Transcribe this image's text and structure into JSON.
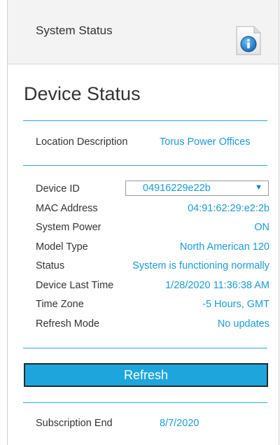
{
  "header": {
    "title": "System Status",
    "info_icon": "info-icon"
  },
  "page_title": "Device Status",
  "location": {
    "label": "Location Description",
    "value": "Torus Power Offices"
  },
  "device_select": {
    "label": "Device ID",
    "value": "04916229e22b",
    "arrow_icon": "chevron-down-icon"
  },
  "info_rows": [
    {
      "label": "MAC Address",
      "value": "04:91:62:29:e2:2b"
    },
    {
      "label": "System Power",
      "value": "ON"
    },
    {
      "label": "Model Type",
      "value": "North American 120"
    },
    {
      "label": "Status",
      "value": "System is functioning normally"
    },
    {
      "label": "Device Last Time",
      "value": "1/28/2020 11:36:38 AM"
    },
    {
      "label": "Time Zone",
      "value": "-5 Hours, GMT"
    },
    {
      "label": "Refresh Mode",
      "value": "No updates"
    }
  ],
  "refresh_button": {
    "label": "Refresh"
  },
  "subscription": {
    "label": "Subscription End",
    "value": "8/7/2020"
  },
  "colors": {
    "accent": "#1ea6dc",
    "value_text": "#1b9ad6",
    "label_text": "#333333",
    "header_bg": "#f3f3f3"
  }
}
